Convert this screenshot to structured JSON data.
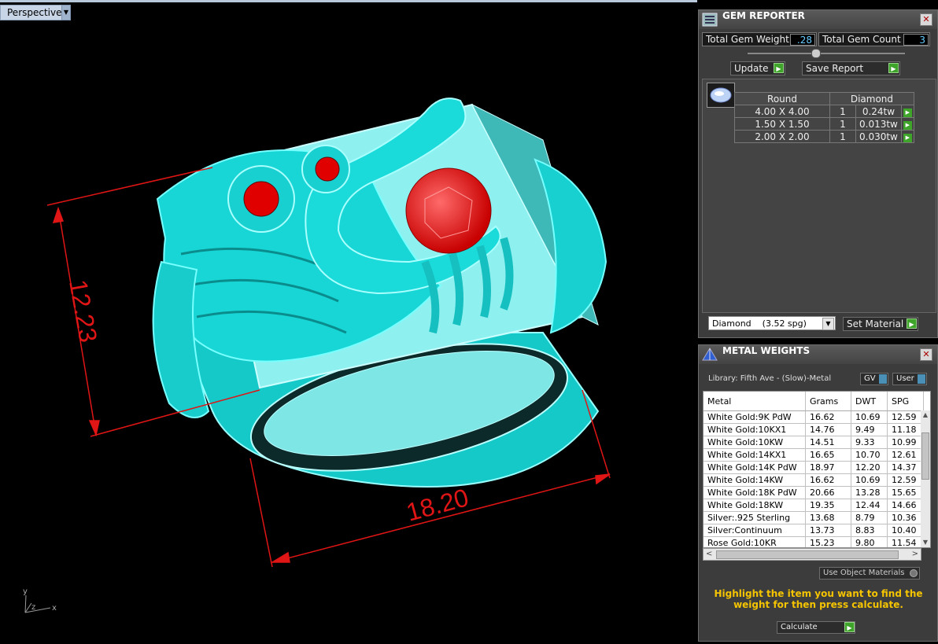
{
  "viewport": {
    "label": "Perspective",
    "dimensions": [
      "12.23",
      "18.20"
    ],
    "axis_labels": {
      "x": "x",
      "y": "y",
      "z": "z"
    }
  },
  "gem_reporter": {
    "title": "GEM REPORTER",
    "total_weight_label": "Total Gem Weight",
    "total_weight_value": ".28",
    "total_count_label": "Total Gem Count",
    "total_count_value": "3",
    "update_label": "Update",
    "save_report_label": "Save Report",
    "headers": [
      "Round",
      "Diamond"
    ],
    "rows": [
      {
        "size": "4.00 X 4.00",
        "qty": "1",
        "weight": "0.24tw"
      },
      {
        "size": "1.50 X 1.50",
        "qty": "1",
        "weight": "0.013tw"
      },
      {
        "size": "2.00 X 2.00",
        "qty": "1",
        "weight": "0.030tw"
      }
    ],
    "material_select": "Diamond    (3.52 spg)",
    "set_material_label": "Set Material"
  },
  "metal_weights": {
    "title": "METAL WEIGHTS",
    "library": "Library: Fifth Ave - (Slow)-Metal",
    "gv_label": "GV",
    "user_label": "User",
    "columns": [
      "Metal",
      "Grams",
      "DWT",
      "SPG"
    ],
    "rows": [
      [
        "White Gold:9K PdW",
        "16.62",
        "10.69",
        "12.59"
      ],
      [
        "White Gold:10KX1",
        "14.76",
        "9.49",
        "11.18"
      ],
      [
        "White Gold:10KW",
        "14.51",
        "9.33",
        "10.99"
      ],
      [
        "White Gold:14KX1",
        "16.65",
        "10.70",
        "12.61"
      ],
      [
        "White Gold:14K PdW",
        "18.97",
        "12.20",
        "14.37"
      ],
      [
        "White Gold:14KW",
        "16.62",
        "10.69",
        "12.59"
      ],
      [
        "White Gold:18K PdW",
        "20.66",
        "13.28",
        "15.65"
      ],
      [
        "White Gold:18KW",
        "19.35",
        "12.44",
        "14.66"
      ],
      [
        "Silver:.925 Sterling",
        "13.68",
        "8.79",
        "10.36"
      ],
      [
        "Silver:Continuum",
        "13.73",
        "8.83",
        "10.40"
      ],
      [
        "Rose Gold:10KR",
        "15.23",
        "9.80",
        "11.54"
      ]
    ],
    "use_object_materials": "Use Object Materials",
    "instruction": "Highlight the item you want to find the weight for then press calculate.",
    "calculate_label": "Calculate"
  }
}
